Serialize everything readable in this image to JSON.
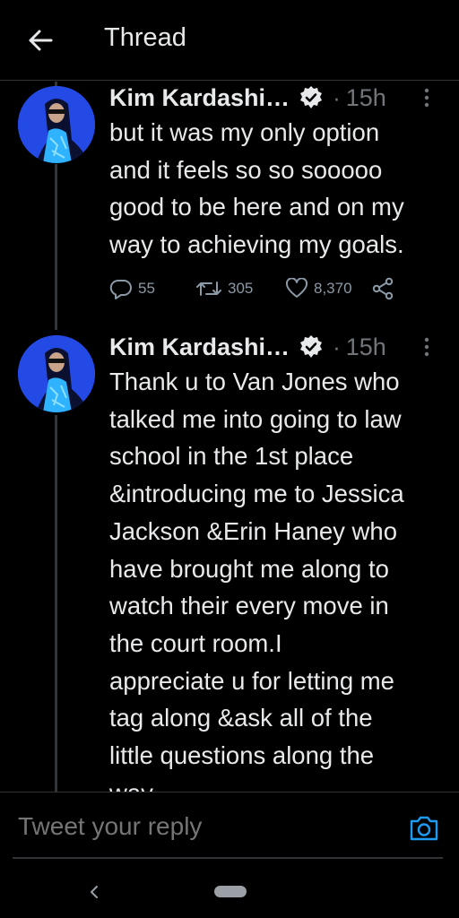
{
  "header": {
    "title": "Thread",
    "back_icon": "arrow-left-icon"
  },
  "tweets": [
    {
      "author": "Kim Kardashi…",
      "separator": "·",
      "time": "15h",
      "text": "but it was my only option\nand it feels so so sooooo\ngood to be here and on my\nway to achieving my goals.",
      "replies": "55",
      "retweets": "305",
      "likes": "8,370"
    },
    {
      "author": "Kim Kardashi…",
      "separator": "·",
      "time": "15h",
      "text": "Thank u to Van Jones who\ntalked me into going to law\nschool in the 1st place\n&introducing me to Jessica\nJackson &Erin Haney who\nhave brought me along to\nwatch their every move in\nthe court room.I\nappreciate u for letting me\ntag along &ask all of the\nlittle questions along the\nway."
    }
  ],
  "reply": {
    "placeholder": "Tweet your reply"
  },
  "colors": {
    "background": "#000000",
    "accent": "#1d9bf0",
    "text_primary": "#e7e9ea",
    "text_secondary": "#71767b",
    "divider": "#2f3336"
  }
}
